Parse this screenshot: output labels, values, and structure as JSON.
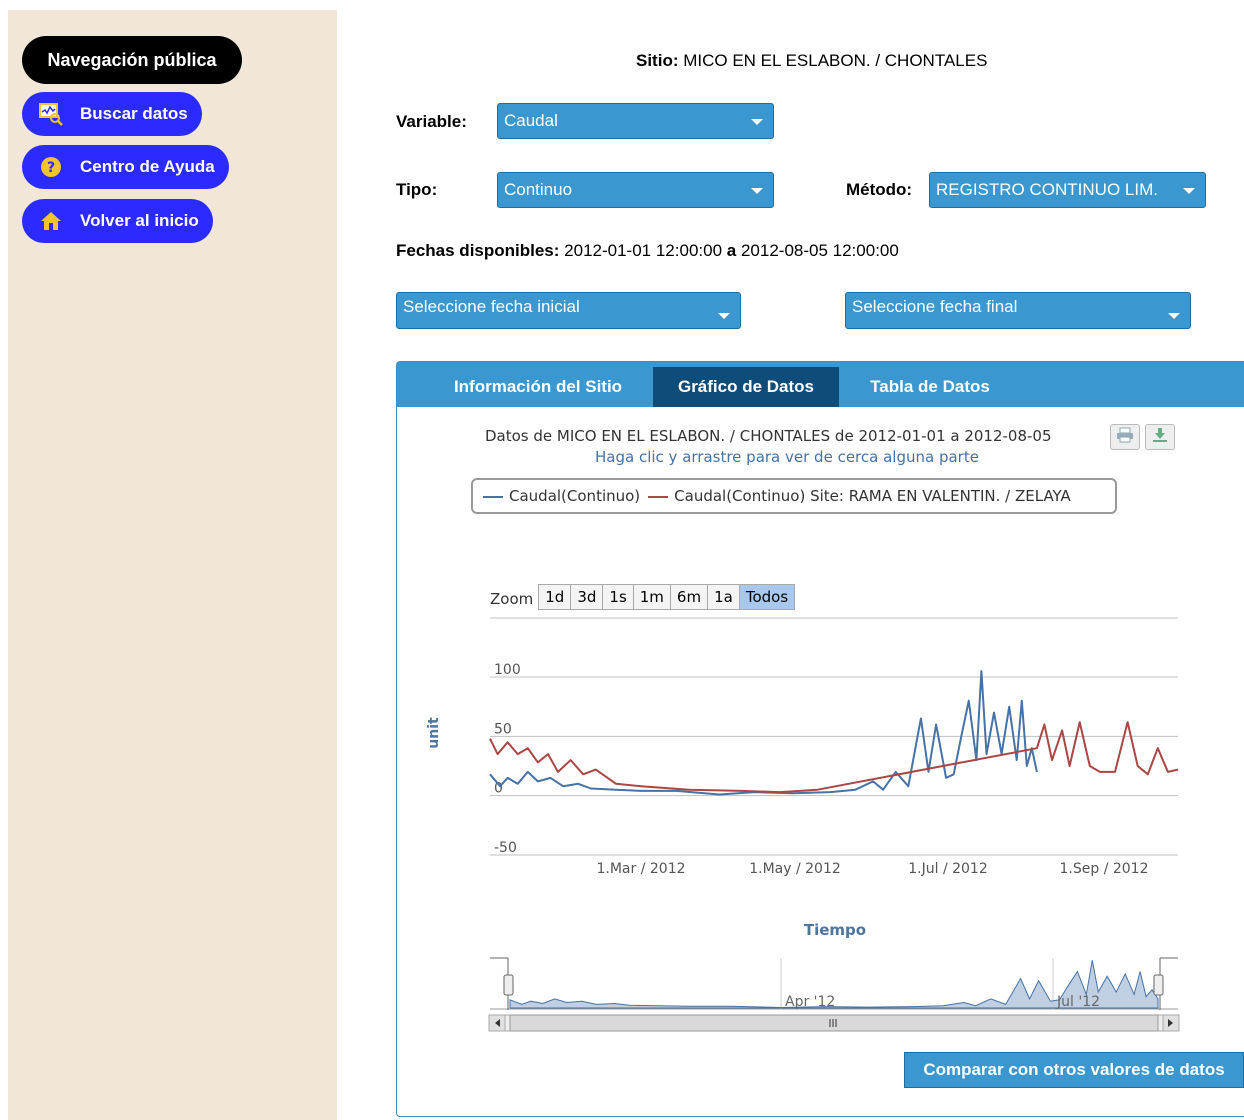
{
  "sidebar": {
    "title": "Navegación pública",
    "items": [
      {
        "label": "Buscar datos",
        "icon": "chart-search-icon"
      },
      {
        "label": "Centro de Ayuda",
        "icon": "help-icon"
      },
      {
        "label": "Volver al inicio",
        "icon": "home-icon"
      }
    ]
  },
  "site": {
    "label": "Sitio:",
    "value": "MICO EN EL ESLABON. / CHONTALES"
  },
  "variable": {
    "label": "Variable:",
    "value": "Caudal"
  },
  "tipo": {
    "label": "Tipo:",
    "value": "Continuo"
  },
  "metodo": {
    "label": "Método:",
    "value": "REGISTRO CONTINUO LIM."
  },
  "fechas": {
    "label": "Fechas disponibles:",
    "start": "2012-01-01 12:00:00",
    "sep": "a",
    "end": "2012-08-05 12:00:00"
  },
  "date_selects": {
    "start_placeholder": "Seleccione fecha inicial",
    "end_placeholder": "Seleccione fecha final"
  },
  "tabs": [
    {
      "label": "Información del Sitio",
      "active": false
    },
    {
      "label": "Gráfico de Datos",
      "active": true
    },
    {
      "label": "Tabla de Datos",
      "active": false
    }
  ],
  "chart_header": {
    "title": "Datos de MICO EN EL ESLABON. / CHONTALES de 2012-01-01 a 2012-08-05",
    "subtitle": "Haga clic y arrastre para ver de cerca alguna parte"
  },
  "zoom": {
    "label": "Zoom",
    "buttons": [
      "1d",
      "3d",
      "1s",
      "1m",
      "6m",
      "1a",
      "Todos"
    ],
    "selected": "Todos"
  },
  "navigator": {
    "labels": [
      "Apr '12",
      "Jul '12"
    ]
  },
  "compare_button": "Comparar con otros valores de datos",
  "colors": {
    "series1": "#4572a7",
    "series2": "#aa4643",
    "accent": "#3a97cf",
    "sidebar_bg": "#f1e6d8",
    "nav_button": "#2b2bff"
  },
  "chart_data": {
    "type": "line",
    "xlabel": "Tiempo",
    "ylabel": "unit",
    "ylim": [
      -50,
      100
    ],
    "yticks": [
      -50,
      0,
      50,
      100
    ],
    "xticks": [
      "1.Mar / 2012",
      "1.May / 2012",
      "1.Jul / 2012",
      "1.Sep / 2012"
    ],
    "xlim": [
      "2012-01-01",
      "2012-09-30"
    ],
    "grid": true,
    "legend_position": "top",
    "series": [
      {
        "name": "Caudal(Continuo)",
        "color": "#4572a7",
        "points": [
          [
            "2012-01-01",
            18
          ],
          [
            "2012-01-05",
            8
          ],
          [
            "2012-01-08",
            15
          ],
          [
            "2012-01-12",
            10
          ],
          [
            "2012-01-16",
            20
          ],
          [
            "2012-01-20",
            12
          ],
          [
            "2012-01-25",
            15
          ],
          [
            "2012-01-30",
            8
          ],
          [
            "2012-02-05",
            10
          ],
          [
            "2012-02-10",
            6
          ],
          [
            "2012-02-20",
            5
          ],
          [
            "2012-03-01",
            4
          ],
          [
            "2012-03-15",
            4
          ],
          [
            "2012-04-01",
            1
          ],
          [
            "2012-04-15",
            3
          ],
          [
            "2012-04-30",
            2
          ],
          [
            "2012-05-15",
            3
          ],
          [
            "2012-05-25",
            5
          ],
          [
            "2012-06-01",
            12
          ],
          [
            "2012-06-05",
            5
          ],
          [
            "2012-06-10",
            20
          ],
          [
            "2012-06-15",
            8
          ],
          [
            "2012-06-20",
            65
          ],
          [
            "2012-06-23",
            20
          ],
          [
            "2012-06-26",
            60
          ],
          [
            "2012-06-30",
            15
          ],
          [
            "2012-07-03",
            18
          ],
          [
            "2012-07-06",
            50
          ],
          [
            "2012-07-09",
            80
          ],
          [
            "2012-07-12",
            30
          ],
          [
            "2012-07-14",
            105
          ],
          [
            "2012-07-16",
            35
          ],
          [
            "2012-07-19",
            70
          ],
          [
            "2012-07-22",
            35
          ],
          [
            "2012-07-25",
            75
          ],
          [
            "2012-07-28",
            30
          ],
          [
            "2012-07-30",
            80
          ],
          [
            "2012-08-01",
            25
          ],
          [
            "2012-08-03",
            40
          ],
          [
            "2012-08-05",
            20
          ]
        ]
      },
      {
        "name": "Caudal(Continuo) Site: RAMA EN VALENTIN. / ZELAYA",
        "color": "#aa4643",
        "points": [
          [
            "2012-01-01",
            48
          ],
          [
            "2012-01-04",
            35
          ],
          [
            "2012-01-08",
            45
          ],
          [
            "2012-01-12",
            35
          ],
          [
            "2012-01-16",
            40
          ],
          [
            "2012-01-20",
            28
          ],
          [
            "2012-01-24",
            35
          ],
          [
            "2012-01-28",
            20
          ],
          [
            "2012-02-02",
            30
          ],
          [
            "2012-02-07",
            18
          ],
          [
            "2012-02-12",
            22
          ],
          [
            "2012-02-20",
            10
          ],
          [
            "2012-03-01",
            8
          ],
          [
            "2012-03-20",
            5
          ],
          [
            "2012-04-10",
            4
          ],
          [
            "2012-04-25",
            3
          ],
          [
            "2012-05-10",
            5
          ],
          [
            "2012-08-05",
            40
          ],
          [
            "2012-08-08",
            60
          ],
          [
            "2012-08-11",
            30
          ],
          [
            "2012-08-15",
            55
          ],
          [
            "2012-08-18",
            25
          ],
          [
            "2012-08-22",
            62
          ],
          [
            "2012-08-26",
            25
          ],
          [
            "2012-08-30",
            20
          ],
          [
            "2012-09-05",
            20
          ],
          [
            "2012-09-10",
            62
          ],
          [
            "2012-09-14",
            25
          ],
          [
            "2012-09-18",
            18
          ],
          [
            "2012-09-22",
            40
          ],
          [
            "2012-09-26",
            20
          ],
          [
            "2012-09-30",
            22
          ]
        ]
      }
    ]
  }
}
